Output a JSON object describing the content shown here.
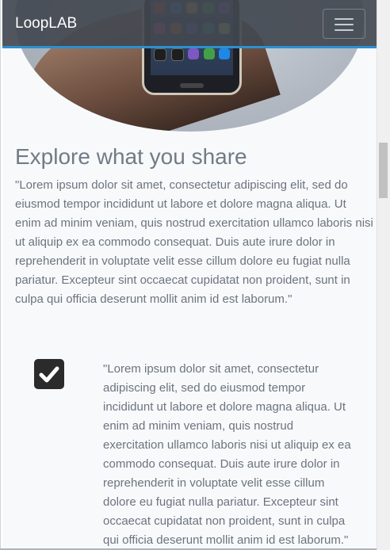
{
  "navbar": {
    "brand": "LoopLAB",
    "toggler_icon": "hamburger-menu-icon"
  },
  "hero": {
    "image": "hand-holding-smartphone-photo"
  },
  "main": {
    "heading": "Explore what you share",
    "paragraph": "\"Lorem ipsum dolor sit amet, consectetur adipiscing elit, sed do eiusmod tempor incididunt ut labore et dolore magna aliqua. Ut enim ad minim veniam, quis nostrud exercitation ullamco laboris nisi ut aliquip ex ea commodo consequat. Duis aute irure dolor in reprehenderit in voluptate velit esse cillum dolore eu fugiat nulla pariatur. Excepteur sint occaecat cupidatat non proident, sunt in culpa qui officia deserunt mollit anim id est laborum.\""
  },
  "feature": {
    "icon": "check-square-icon",
    "text": "\"Lorem ipsum dolor sit amet, consectetur adipiscing elit, sed do eiusmod tempor incididunt ut labore et dolore magna aliqua. Ut enim ad minim veniam, quis nostrud exercitation ullamco laboris nisi ut aliquip ex ea commodo consequat. Duis aute irure dolor in reprehenderit in voluptate velit esse cillum dolore eu fugiat nulla pariatur. Excepteur sint occaecat cupidatat non proident, sunt in culpa qui officia deserunt mollit anim id est laborum.\""
  },
  "colors": {
    "navbar_bg": "#424850",
    "navbar_accent": "#2e8fd0",
    "heading_text": "#717b86",
    "body_text": "#6b747e",
    "page_bg": "#f8f9fb"
  }
}
